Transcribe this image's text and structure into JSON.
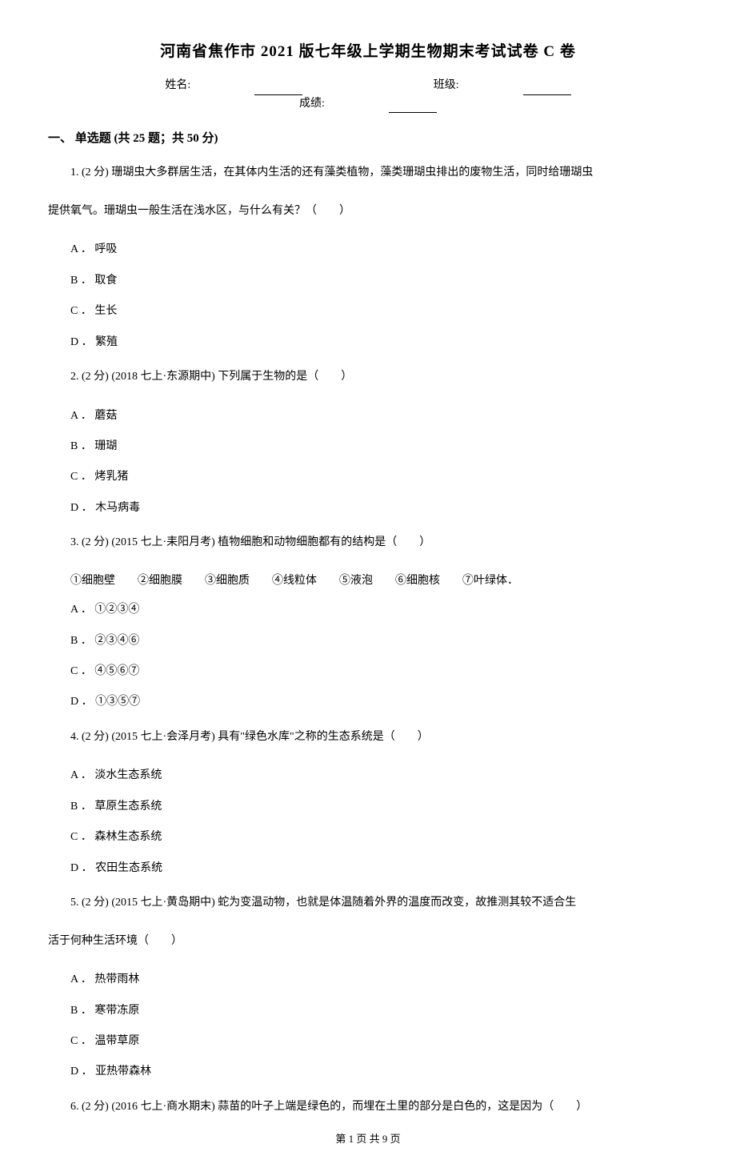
{
  "title": "河南省焦作市 2021 版七年级上学期生物期末考试试卷 C 卷",
  "info": {
    "name_label": "姓名:",
    "class_label": "班级:",
    "score_label": "成绩:"
  },
  "section_header": "一、 单选题 (共 25 题；共 50 分)",
  "questions": [
    {
      "stem_line1": "1.   (2 分)  珊瑚虫大多群居生活，在其体内生活的还有藻类植物，藻类珊瑚虫排出的废物生活，同时给珊瑚虫",
      "stem_line2": "提供氧气。珊瑚虫一般生活在浅水区，与什么有关？（　　）",
      "options": [
        "A ．  呼吸",
        "B ．  取食",
        "C ．  生长",
        "D ．  繁殖"
      ]
    },
    {
      "stem_line1": "2.    (2 分)    (2018 七上·东源期中)  下列属于生物的是（　　）",
      "options": [
        "A ．  蘑菇",
        "B ．  珊瑚",
        "C ．  烤乳猪",
        "D ．  木马病毒"
      ]
    },
    {
      "stem_line1": "3.    (2 分)    (2015 七上·耒阳月考)   植物细胞和动物细胞都有的结构是（　　）",
      "sub_line": "①细胞壁　　②细胞膜　　③细胞质　　④线粒体　　⑤液泡　　⑥细胞核　　⑦叶绿体．",
      "options": [
        "A ．  ①②③④",
        "B ．  ②③④⑥",
        "C ．  ④⑤⑥⑦",
        "D ．  ①③⑤⑦"
      ]
    },
    {
      "stem_line1": "4.    (2 分)    (2015 七上·会泽月考)  具有\"绿色水库\"之称的生态系统是（　　）",
      "options": [
        "A ．  淡水生态系统",
        "B ．  草原生态系统",
        "C ．  森林生态系统",
        "D ．  农田生态系统"
      ]
    },
    {
      "stem_line1": "5.   (2 分)   (2015 七上·黄岛期中)  蛇为变温动物，也就是体温随着外界的温度而改变，故推测其较不适合生",
      "stem_line2": "活于何种生活环境（　　）",
      "options": [
        "A ．  热带雨林",
        "B ．  寒带冻原",
        "C ．  温带草原",
        "D ．  亚热带森林"
      ]
    },
    {
      "stem_line1": "6.    (2 分)    (2016 七上·商水期末)   蒜苗的叶子上端是绿色的，而埋在土里的部分是白色的，这是因为（　　）"
    }
  ],
  "footer": "第 1 页 共 9 页"
}
